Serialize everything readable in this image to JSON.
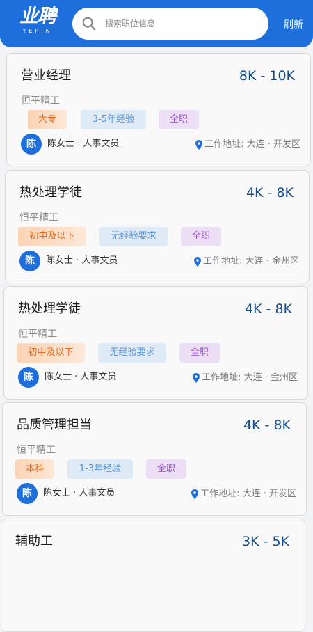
{
  "header": {
    "logo_main": "业聘",
    "logo_sub": "YEPIN",
    "search_placeholder": "搜索职位信息",
    "refresh_label": "刷新"
  },
  "colors": {
    "brand": "#1e6fdc",
    "salary": "#174c8c",
    "tag_edu": "#e76b1c",
    "tag_exp": "#5a95d4",
    "tag_type": "#9b56c6"
  },
  "jobs": [
    {
      "title": "营业经理",
      "salary": "8K - 10K",
      "company": "恒平精工",
      "tags": [
        "大专",
        "3-5年经验",
        "全职"
      ],
      "avatar": "陈",
      "contact": "陈女士 · 人事文员",
      "location": "工作地址: 大连 · 开发区"
    },
    {
      "title": "热处理学徒",
      "salary": "4K - 8K",
      "company": "恒平精工",
      "tags": [
        "初中及以下",
        "无经验要求",
        "全职"
      ],
      "avatar": "陈",
      "contact": "陈女士 · 人事文员",
      "location": "工作地址: 大连 · 金州区"
    },
    {
      "title": "热处理学徒",
      "salary": "4K - 8K",
      "company": "恒平精工",
      "tags": [
        "初中及以下",
        "无经验要求",
        "全职"
      ],
      "avatar": "陈",
      "contact": "陈女士 · 人事文员",
      "location": "工作地址: 大连 · 金州区"
    },
    {
      "title": "品质管理担当",
      "salary": "4K - 8K",
      "company": "恒平精工",
      "tags": [
        "本科",
        "1-3年经验",
        "全职"
      ],
      "avatar": "陈",
      "contact": "陈女士 · 人事文员",
      "location": "工作地址: 大连 · 开发区"
    },
    {
      "title": "辅助工",
      "salary": "3K - 5K"
    }
  ]
}
